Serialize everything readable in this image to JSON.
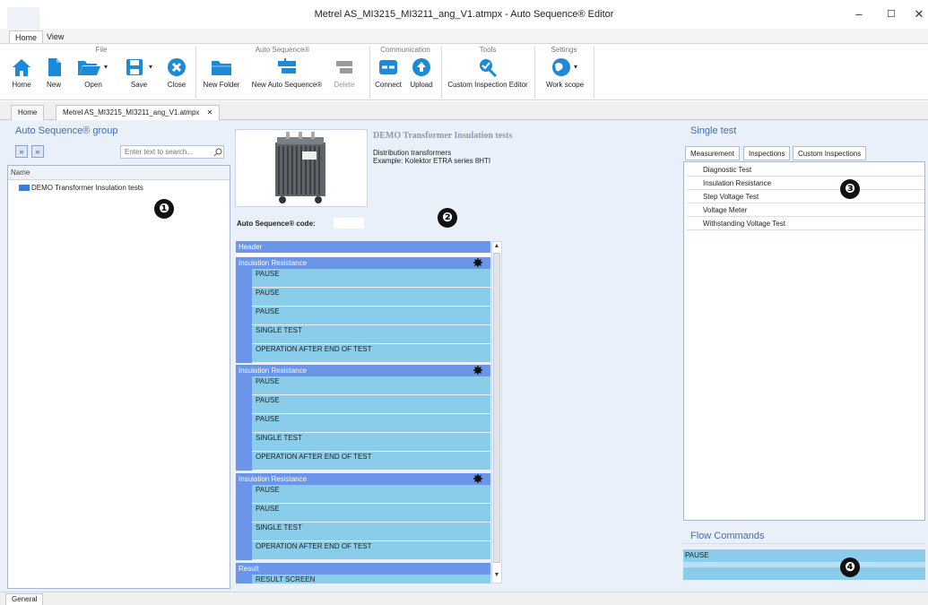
{
  "window": {
    "title": "Metrel AS_MI3215_MI3211_ang_V1.atmpx - Auto Sequence® Editor",
    "minimize": "–",
    "maximize": "☐",
    "close": "✕"
  },
  "ribbon": {
    "tabs": [
      "Home",
      "View"
    ],
    "groups": {
      "file": "File",
      "auto_sequence": "Auto Sequence®",
      "communication": "Communication",
      "tools": "Tools",
      "settings": "Settings"
    },
    "buttons": {
      "home": "Home",
      "new": "New",
      "open": "Open",
      "save": "Save",
      "close": "Close",
      "new_folder": "New Folder",
      "new_auto_sequence": "New Auto Sequence®",
      "delete": "Delete",
      "connect": "Connect",
      "upload": "Upload",
      "custom_inspection_editor": "Custom Inspection Editor",
      "work_scope": "Work scope"
    },
    "icons": [
      "home-icon",
      "new-file-icon",
      "open-folder-icon",
      "save-icon",
      "close-icon",
      "new-folder-icon",
      "new-sequence-icon",
      "delete-icon",
      "connect-icon",
      "upload-icon",
      "custom-inspection-icon",
      "work-scope-icon"
    ],
    "accent": "#1e8ad6"
  },
  "doc_tabs": {
    "home": "Home",
    "file": "Metrel AS_MI3215_MI3211_ang_V1.atmpx",
    "close": "✕"
  },
  "left": {
    "title": "Auto Sequence® group",
    "expand": "»",
    "collapse": "«",
    "search_placeholder": "Enter text to search...",
    "column_name": "Name",
    "tree_item": "DEMO Transformer Insulation tests",
    "badge": "❶"
  },
  "center": {
    "title": "DEMO Transformer Insulation tests",
    "desc1": "Distribution transformers",
    "desc2": "Example: Kolektor ETRA series 8HTI",
    "code_label": "Auto Sequence® code:",
    "badge": "❷",
    "header": "Header",
    "blocks": [
      {
        "title": "Insulation Resistance",
        "steps": [
          "PAUSE",
          "PAUSE",
          "PAUSE",
          "SINGLE TEST",
          "OPERATION AFTER END OF TEST"
        ]
      },
      {
        "title": "Insulation Resistance",
        "steps": [
          "PAUSE",
          "PAUSE",
          "PAUSE",
          "SINGLE TEST",
          "OPERATION AFTER END OF TEST"
        ]
      },
      {
        "title": "Insulation Resistance",
        "steps": [
          "PAUSE",
          "PAUSE",
          "SINGLE TEST",
          "OPERATION AFTER END OF TEST"
        ]
      }
    ],
    "result": "Result",
    "result_step": "RESULT SCREEN"
  },
  "right": {
    "title": "Single test",
    "tabs": [
      "Measurement",
      "Inspections",
      "Custom Inspections"
    ],
    "items": [
      "Diagnostic Test",
      "Insulation Resistance",
      "Step Voltage Test",
      "Voltage Meter",
      "Withstanding Voltage Test"
    ],
    "badge3": "❸",
    "flow_title": "Flow Commands",
    "flow_items": [
      "PAUSE"
    ],
    "badge4": "❹"
  },
  "status": {
    "tab": "General"
  }
}
